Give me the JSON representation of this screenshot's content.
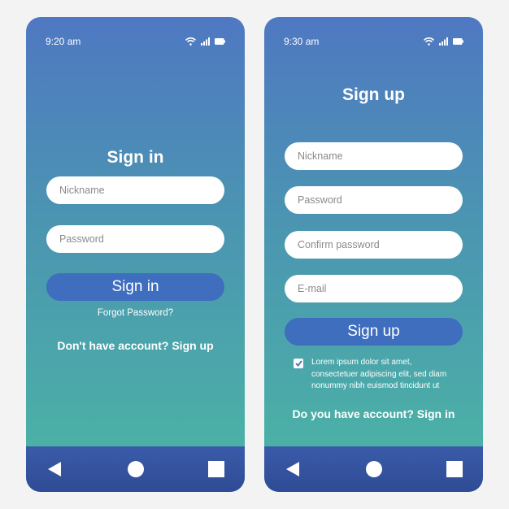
{
  "signin": {
    "time": "9:20 am",
    "title": "Sign in",
    "nickname_placeholder": "Nickname",
    "password_placeholder": "Password",
    "button": "Sign in",
    "forgot": "Forgot Password?",
    "signup_prompt": "Don't have account? Sign up"
  },
  "signup": {
    "time": "9:30 am",
    "title": "Sign up",
    "nickname_placeholder": "Nickname",
    "password_placeholder": "Password",
    "confirm_placeholder": "Confirm password",
    "email_placeholder": "E-mail",
    "button": "Sign up",
    "terms_text": "Lorem ipsum dolor sit amet, consectetuer adipiscing elit, sed diam nonummy nibh euismod tincidunt ut",
    "terms_checked": true,
    "signin_prompt": "Do you have account? Sign in"
  },
  "status_icons": [
    "wifi-icon",
    "signal-icon",
    "battery-icon"
  ],
  "nav_icons": [
    "back-icon",
    "home-icon",
    "recents-icon"
  ],
  "colors": {
    "gradient_top": "#4f78c2",
    "gradient_bottom": "#4bb6a4",
    "button": "#3f6ebf",
    "nav_bar": "#2f4b95"
  }
}
